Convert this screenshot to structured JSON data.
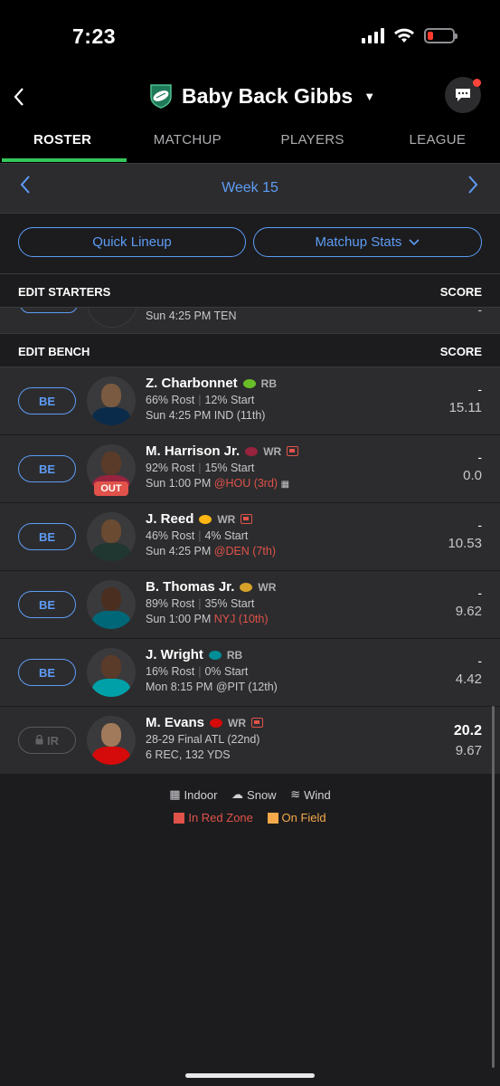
{
  "status_bar": {
    "time": "7:23"
  },
  "header": {
    "team_name": "Baby Back Gibbs"
  },
  "tabs": [
    {
      "label": "ROSTER",
      "active": true
    },
    {
      "label": "MATCHUP"
    },
    {
      "label": "PLAYERS"
    },
    {
      "label": "LEAGUE"
    }
  ],
  "week": {
    "label": "Week 15"
  },
  "buttons": {
    "quick_lineup": "Quick Lineup",
    "matchup_stats": "Matchup Stats"
  },
  "starters": {
    "title": "EDIT STARTERS",
    "score_label": "SCORE",
    "partial_row_game": "Sun 4:25 PM TEN"
  },
  "bench": {
    "title": "EDIT BENCH",
    "score_label": "SCORE",
    "players": [
      {
        "slot": "BE",
        "name": "Z. Charbonnet",
        "pos": "RB",
        "rost": "66% Rost",
        "start": "12% Start",
        "game": "Sun 4:25 PM IND (11th)",
        "opp_red": "",
        "score": "-",
        "proj": "15.11",
        "team_color": "#69be28"
      },
      {
        "slot": "BE",
        "name": "M. Harrison Jr.",
        "pos": "WR",
        "rost": "92% Rost",
        "start": "15% Start",
        "game_pre": "Sun 1:00 PM",
        "opp_red": "@HOU (3rd)",
        "status": "OUT",
        "score": "-",
        "proj": "0.0",
        "team_color": "#97233f"
      },
      {
        "slot": "BE",
        "name": "J. Reed",
        "pos": "WR",
        "rost": "46% Rost",
        "start": "4% Start",
        "game_pre": "Sun 4:25 PM",
        "opp_red": "@DEN (7th)",
        "score": "-",
        "proj": "10.53",
        "team_color": "#203731"
      },
      {
        "slot": "BE",
        "name": "B. Thomas Jr.",
        "pos": "WR",
        "rost": "89% Rost",
        "start": "35% Start",
        "game_pre": "Sun 1:00 PM",
        "opp_red": "NYJ (10th)",
        "score": "-",
        "proj": "9.62",
        "team_color": "#006778"
      },
      {
        "slot": "BE",
        "name": "J. Wright",
        "pos": "RB",
        "rost": "16% Rost",
        "start": "0% Start",
        "game": "Mon 8:15 PM @PIT (12th)",
        "opp_red": "",
        "score": "-",
        "proj": "4.42",
        "team_color": "#008e97"
      },
      {
        "slot": "IR",
        "name": "M. Evans",
        "pos": "WR",
        "line2": "28-29 Final ATL (22nd)",
        "line3": "6 REC, 132 YDS",
        "score": "20.2",
        "proj": "9.67",
        "team_color": "#d50a0a"
      }
    ]
  },
  "legend": {
    "indoor": "Indoor",
    "snow": "Snow",
    "wind": "Wind",
    "red_zone": "In Red Zone",
    "on_field": "On Field",
    "red_zone_color": "#e0524a",
    "on_field_color": "#f5a94a"
  },
  "colors": {
    "accent": "#5e9cf5",
    "tab_active": "#34c759"
  }
}
